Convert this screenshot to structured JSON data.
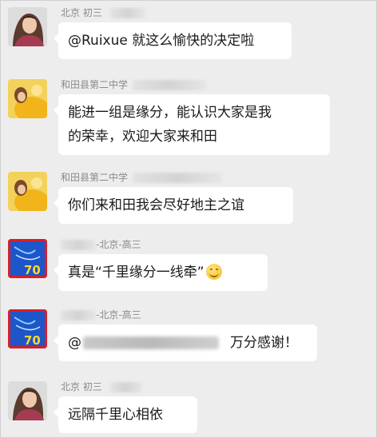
{
  "messages": [
    {
      "avatar": "portrait-avatar",
      "sender": "北京 初三",
      "text": "@Ruixue  就这么愉快的决定啦"
    },
    {
      "avatar": "yellow-dress-avatar",
      "sender": "和田县第二中学",
      "text_lines": [
        "能进一组是缘分，能认识大家是我",
        "的荣幸，欢迎大家来和田"
      ]
    },
    {
      "avatar": "yellow-dress-avatar",
      "sender": "和田县第二中学",
      "text": "你们来和田我会尽好地主之谊"
    },
    {
      "avatar": "blue-70-logo-avatar",
      "sender_suffix": "-北京-高三",
      "text": "真是“千里缘分一线牵”",
      "emoji": "smile-emoji"
    },
    {
      "avatar": "blue-70-logo-avatar",
      "sender_suffix": "-北京-高三",
      "text_prefix": "@",
      "text_suffix": "万分感谢！"
    },
    {
      "avatar": "portrait-avatar",
      "sender": "北京 初三",
      "text": "远隔千里心相依"
    }
  ]
}
